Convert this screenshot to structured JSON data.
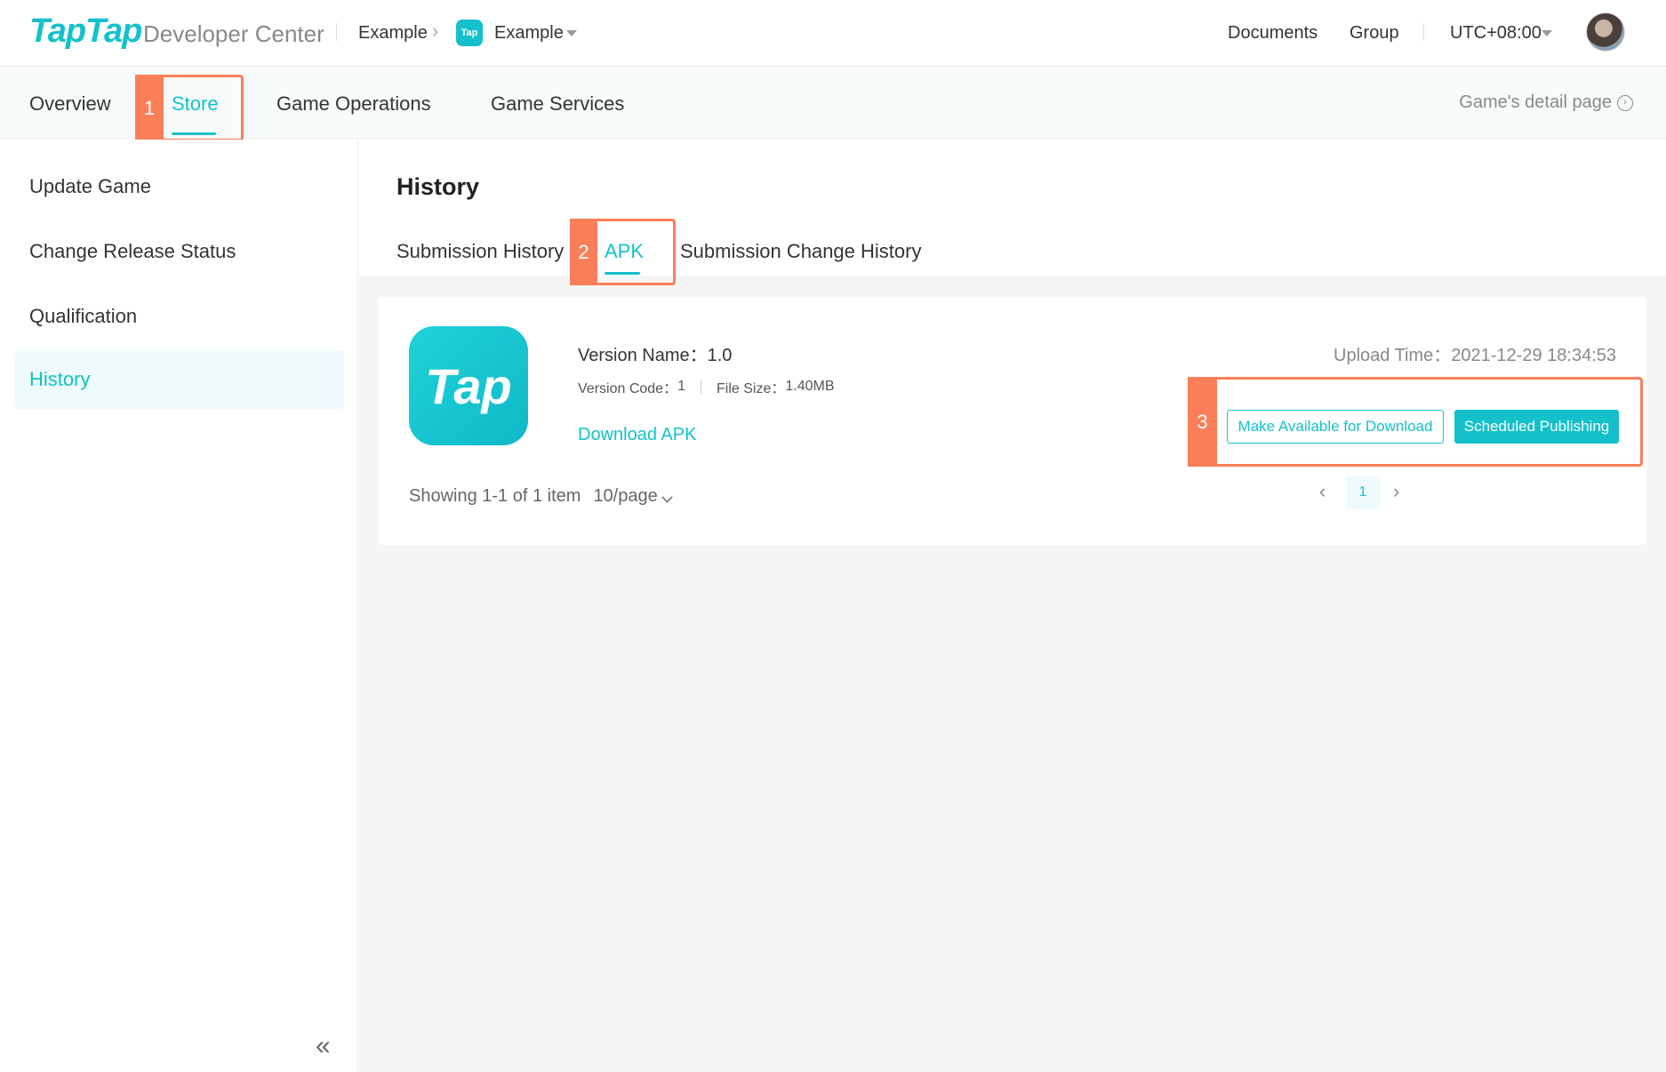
{
  "header": {
    "logo_text": "TapTap",
    "logo_sub": "Developer Center",
    "breadcrumb_org": "Example",
    "app_mini_icon_text": "Tap",
    "breadcrumb_app": "Example",
    "documents": "Documents",
    "group": "Group",
    "timezone": "UTC+08:00"
  },
  "nav": {
    "tabs": [
      {
        "label": "Overview"
      },
      {
        "label": "Store"
      },
      {
        "label": "Game Operations"
      },
      {
        "label": "Game Services"
      }
    ],
    "active_tab": "Store",
    "detail_link": "Game's detail page"
  },
  "sidebar": {
    "items": [
      {
        "label": "Update Game"
      },
      {
        "label": "Change Release Status"
      },
      {
        "label": "Qualification"
      },
      {
        "label": "History"
      }
    ],
    "active_item": "History",
    "collapse_glyph": "«"
  },
  "content": {
    "title": "History",
    "subtabs": [
      {
        "label": "Submission History"
      },
      {
        "label": "APK"
      },
      {
        "label": "Submission Change History"
      }
    ],
    "active_subtab": "APK",
    "card": {
      "icon_text": "Tap",
      "version_name_label": "Version Name：",
      "version_name": "1.0",
      "version_code_label": "Version Code：",
      "version_code": "1",
      "file_size_label": "File Size：",
      "file_size": "1.40MB",
      "download_label": "Download APK",
      "upload_time_label": "Upload Time：",
      "upload_time": "2021-12-29 18:34:53",
      "btn_make_available": "Make Available for Download",
      "btn_scheduled": "Scheduled Publishing",
      "showing": "Showing 1-1 of 1 item",
      "page_size": "10/page",
      "current_page": "1"
    }
  },
  "annotations": [
    "1",
    "2",
    "3"
  ],
  "colors": {
    "accent": "#14c1ca",
    "annotation": "#fa7f58"
  }
}
